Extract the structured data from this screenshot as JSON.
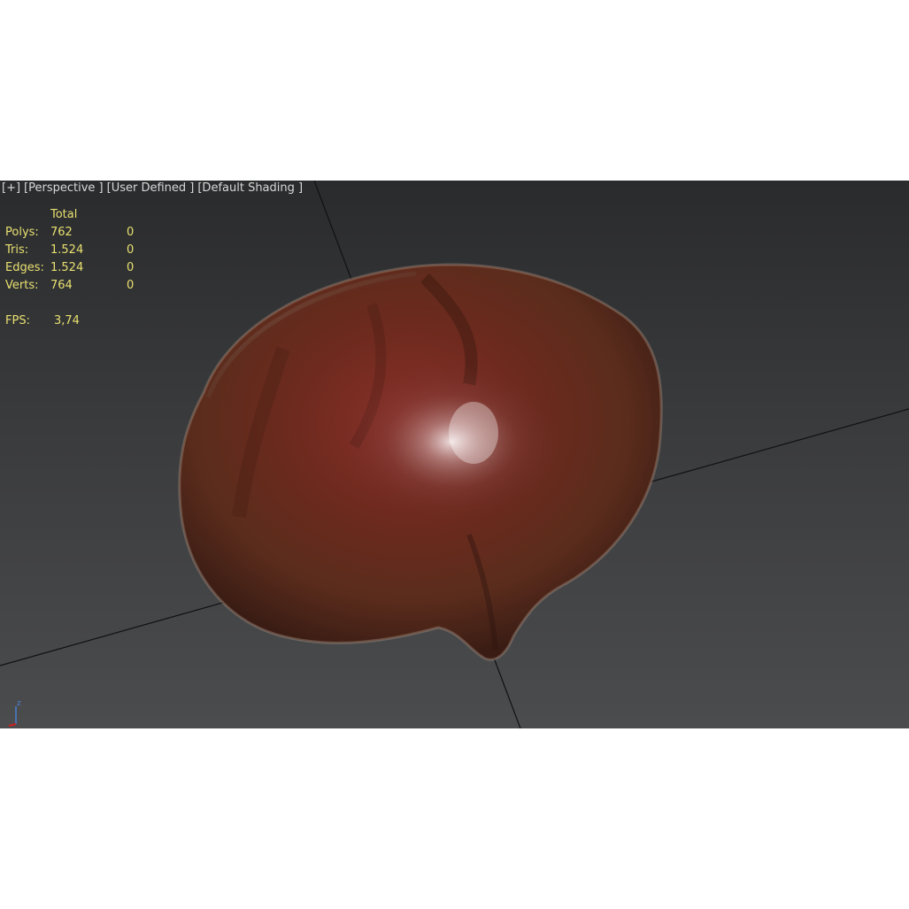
{
  "viewport": {
    "labels": [
      "[+]",
      "[Perspective ]",
      "[User Defined ]",
      "[Default Shading ]"
    ]
  },
  "stats": {
    "header_total": "Total",
    "rows": [
      {
        "label": "Polys:",
        "total": "762",
        "selected": "0"
      },
      {
        "label": "Tris:",
        "total": "1.524",
        "selected": "0"
      },
      {
        "label": "Edges:",
        "total": "1.524",
        "selected": "0"
      },
      {
        "label": "Verts:",
        "total": "764",
        "selected": "0"
      }
    ],
    "fps_label": "FPS:",
    "fps_value": "3,74"
  },
  "gizmo": {
    "axis_label": "z"
  },
  "colors": {
    "stats_text": "#e8e070",
    "label_text": "#d8d8d8",
    "grid_line": "#111111",
    "gizmo_z": "#4a7fd0",
    "gizmo_x": "#d02020"
  },
  "icons": [
    "axis-gizmo-icon"
  ]
}
